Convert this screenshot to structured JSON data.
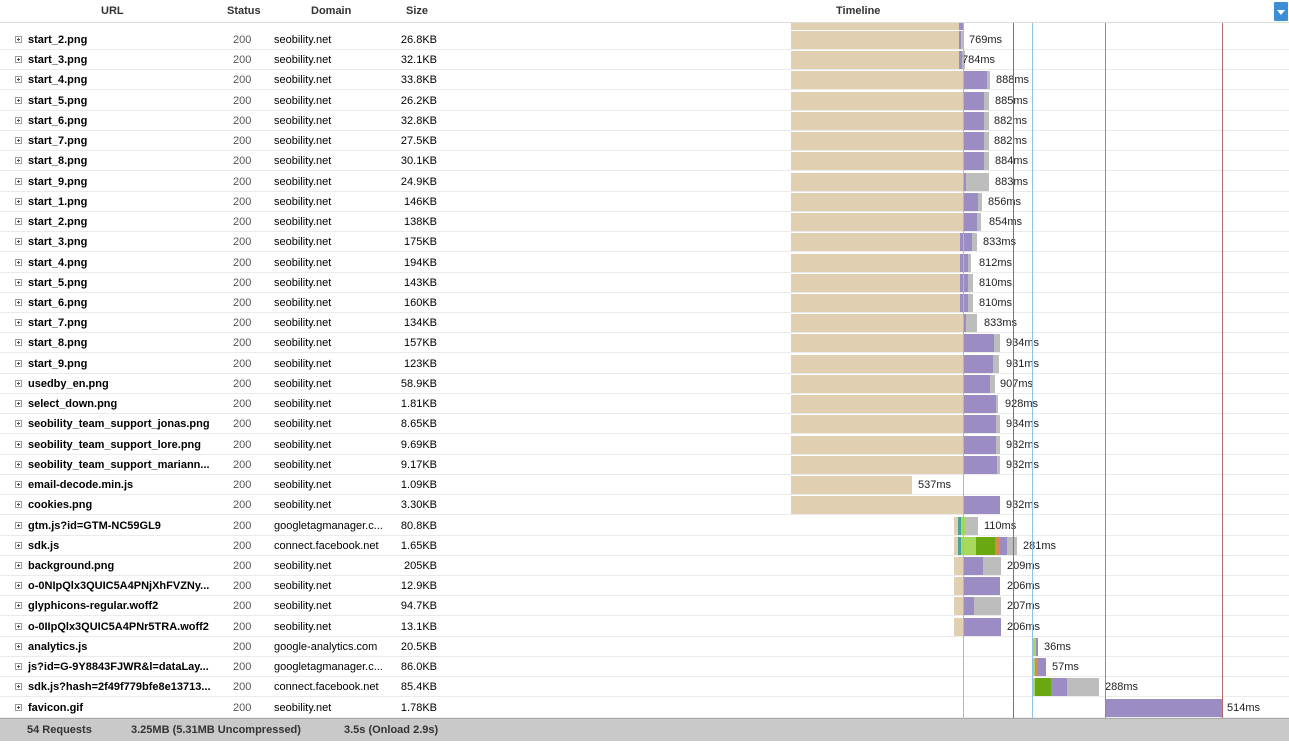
{
  "header": {
    "url": "URL",
    "status": "Status",
    "domain": "Domain",
    "size": "Size",
    "timeline": "Timeline"
  },
  "rows": [
    {
      "url": "start_2.png",
      "status": "200",
      "domain": "seobility.net",
      "size": "26.8KB",
      "time": "769ms"
    },
    {
      "url": "start_3.png",
      "status": "200",
      "domain": "seobility.net",
      "size": "32.1KB",
      "time": "784ms"
    },
    {
      "url": "start_4.png",
      "status": "200",
      "domain": "seobility.net",
      "size": "33.8KB",
      "time": "888ms"
    },
    {
      "url": "start_5.png",
      "status": "200",
      "domain": "seobility.net",
      "size": "26.2KB",
      "time": "885ms"
    },
    {
      "url": "start_6.png",
      "status": "200",
      "domain": "seobility.net",
      "size": "32.8KB",
      "time": "882ms"
    },
    {
      "url": "start_7.png",
      "status": "200",
      "domain": "seobility.net",
      "size": "27.5KB",
      "time": "882ms"
    },
    {
      "url": "start_8.png",
      "status": "200",
      "domain": "seobility.net",
      "size": "30.1KB",
      "time": "884ms"
    },
    {
      "url": "start_9.png",
      "status": "200",
      "domain": "seobility.net",
      "size": "24.9KB",
      "time": "883ms"
    },
    {
      "url": "start_1.png",
      "status": "200",
      "domain": "seobility.net",
      "size": "146KB",
      "time": "856ms"
    },
    {
      "url": "start_2.png",
      "status": "200",
      "domain": "seobility.net",
      "size": "138KB",
      "time": "854ms"
    },
    {
      "url": "start_3.png",
      "status": "200",
      "domain": "seobility.net",
      "size": "175KB",
      "time": "833ms"
    },
    {
      "url": "start_4.png",
      "status": "200",
      "domain": "seobility.net",
      "size": "194KB",
      "time": "812ms"
    },
    {
      "url": "start_5.png",
      "status": "200",
      "domain": "seobility.net",
      "size": "143KB",
      "time": "810ms"
    },
    {
      "url": "start_6.png",
      "status": "200",
      "domain": "seobility.net",
      "size": "160KB",
      "time": "810ms"
    },
    {
      "url": "start_7.png",
      "status": "200",
      "domain": "seobility.net",
      "size": "134KB",
      "time": "833ms"
    },
    {
      "url": "start_8.png",
      "status": "200",
      "domain": "seobility.net",
      "size": "157KB",
      "time": "934ms"
    },
    {
      "url": "start_9.png",
      "status": "200",
      "domain": "seobility.net",
      "size": "123KB",
      "time": "931ms"
    },
    {
      "url": "usedby_en.png",
      "status": "200",
      "domain": "seobility.net",
      "size": "58.9KB",
      "time": "907ms"
    },
    {
      "url": "select_down.png",
      "status": "200",
      "domain": "seobility.net",
      "size": "1.81KB",
      "time": "928ms"
    },
    {
      "url": "seobility_team_support_jonas.png",
      "status": "200",
      "domain": "seobility.net",
      "size": "8.65KB",
      "time": "934ms"
    },
    {
      "url": "seobility_team_support_lore.png",
      "status": "200",
      "domain": "seobility.net",
      "size": "9.69KB",
      "time": "932ms"
    },
    {
      "url": "seobility_team_support_mariann...",
      "status": "200",
      "domain": "seobility.net",
      "size": "9.17KB",
      "time": "932ms"
    },
    {
      "url": "email-decode.min.js",
      "status": "200",
      "domain": "seobility.net",
      "size": "1.09KB",
      "time": "537ms"
    },
    {
      "url": "cookies.png",
      "status": "200",
      "domain": "seobility.net",
      "size": "3.30KB",
      "time": "932ms"
    },
    {
      "url": "gtm.js?id=GTM-NC59GL9",
      "status": "200",
      "domain": "googletagmanager.c...",
      "size": "80.8KB",
      "time": "110ms"
    },
    {
      "url": "sdk.js",
      "status": "200",
      "domain": "connect.facebook.net",
      "size": "1.65KB",
      "time": "281ms"
    },
    {
      "url": "background.png",
      "status": "200",
      "domain": "seobility.net",
      "size": "205KB",
      "time": "209ms"
    },
    {
      "url": "o-0NIpQlx3QUIC5A4PNjXhFVZNy...",
      "status": "200",
      "domain": "seobility.net",
      "size": "12.9KB",
      "time": "206ms"
    },
    {
      "url": "glyphicons-regular.woff2",
      "status": "200",
      "domain": "seobility.net",
      "size": "94.7KB",
      "time": "207ms"
    },
    {
      "url": "o-0IIpQlx3QUIC5A4PNr5TRA.woff2",
      "status": "200",
      "domain": "seobility.net",
      "size": "13.1KB",
      "time": "206ms"
    },
    {
      "url": "analytics.js",
      "status": "200",
      "domain": "google-analytics.com",
      "size": "20.5KB",
      "time": "36ms"
    },
    {
      "url": "js?id=G-9Y8843FJWR&l=dataLay...",
      "status": "200",
      "domain": "googletagmanager.c...",
      "size": "86.0KB",
      "time": "57ms"
    },
    {
      "url": "sdk.js?hash=2f49f779bfe8e13713...",
      "status": "200",
      "domain": "connect.facebook.net",
      "size": "85.4KB",
      "time": "288ms"
    },
    {
      "url": "favicon.gif",
      "status": "200",
      "domain": "seobility.net",
      "size": "1.78KB",
      "time": "514ms"
    }
  ],
  "footer": {
    "requests": "54 Requests",
    "size": "3.25MB  (5.31MB Uncompressed)",
    "time": "3.5s  (Onload 2.9s)"
  },
  "colors": {
    "accent": "#3c8ed6",
    "wait": "#e1cfb1",
    "receive": "#9b8cc4",
    "blocked": "#bdbdbd",
    "dom_content_line": "#5b8fd1",
    "onload_line": "#b05050"
  }
}
